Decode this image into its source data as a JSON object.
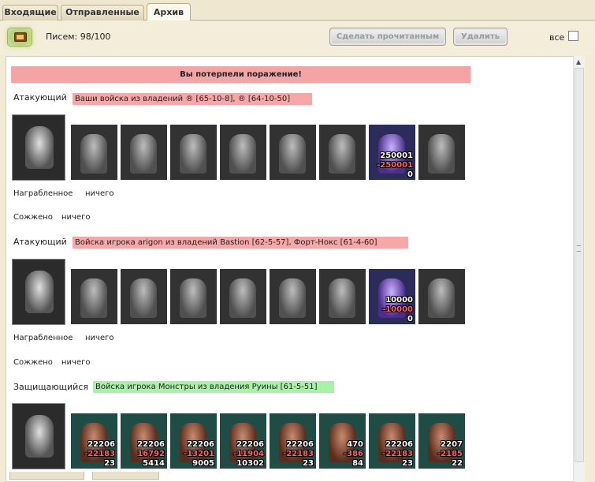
{
  "tabs": [
    "Входящие",
    "Отправленные",
    "Архив"
  ],
  "toolbar": {
    "letters_label": "Писем: 98/100",
    "mark_read": "Сделать прочитанным",
    "delete": "Удалить",
    "all": "все"
  },
  "battle": {
    "banner": "Вы потерпели поражение!",
    "sections": [
      {
        "role": "Атакующий",
        "owner": "Ваши войска из владений ® [65-10-8], ® [64-10-50]",
        "units": [
          {
            "values": []
          },
          {
            "values": []
          },
          {
            "values": []
          },
          {
            "values": []
          },
          {
            "values": []
          },
          {
            "values": []
          },
          {
            "values": []
          },
          {
            "values": [
              "250001",
              "-250001",
              "0"
            ]
          },
          {
            "values": []
          }
        ],
        "loot_label": "Награбленное",
        "loot_value": "ничего",
        "burn_label": "Сожжено",
        "burn_value": "ничего"
      },
      {
        "role": "Атакующий",
        "owner": "Войска игрока arigon из владений Bastion [62-5-57], Форт-Нокс [61-4-60]",
        "units": [
          {
            "values": []
          },
          {
            "values": []
          },
          {
            "values": []
          },
          {
            "values": []
          },
          {
            "values": []
          },
          {
            "values": []
          },
          {
            "values": []
          },
          {
            "values": [
              "10000",
              "-10000",
              "0"
            ]
          },
          {
            "values": []
          }
        ],
        "loot_label": "Награбленное",
        "loot_value": "ничего",
        "burn_label": "Сожжено",
        "burn_value": "ничего"
      },
      {
        "role": "Защищающийся",
        "owner": "Войска игрока Монстры из владения Руины [61-5-51]",
        "units": [
          {
            "values": [
              "22206",
              "-22183",
              "23"
            ]
          },
          {
            "values": [
              "22206",
              "16792",
              "5414"
            ]
          },
          {
            "values": [
              "22206",
              "-13201",
              "9005"
            ]
          },
          {
            "values": [
              "22206",
              "-11904",
              "10302"
            ]
          },
          {
            "values": [
              "22206",
              "-22183",
              "23"
            ]
          },
          {
            "values": [
              "470",
              "-386",
              "84"
            ]
          },
          {
            "values": [
              "22206",
              "-22183",
              "23"
            ]
          },
          {
            "values": [
              "2207",
              "-2185",
              "22"
            ]
          }
        ]
      }
    ]
  }
}
